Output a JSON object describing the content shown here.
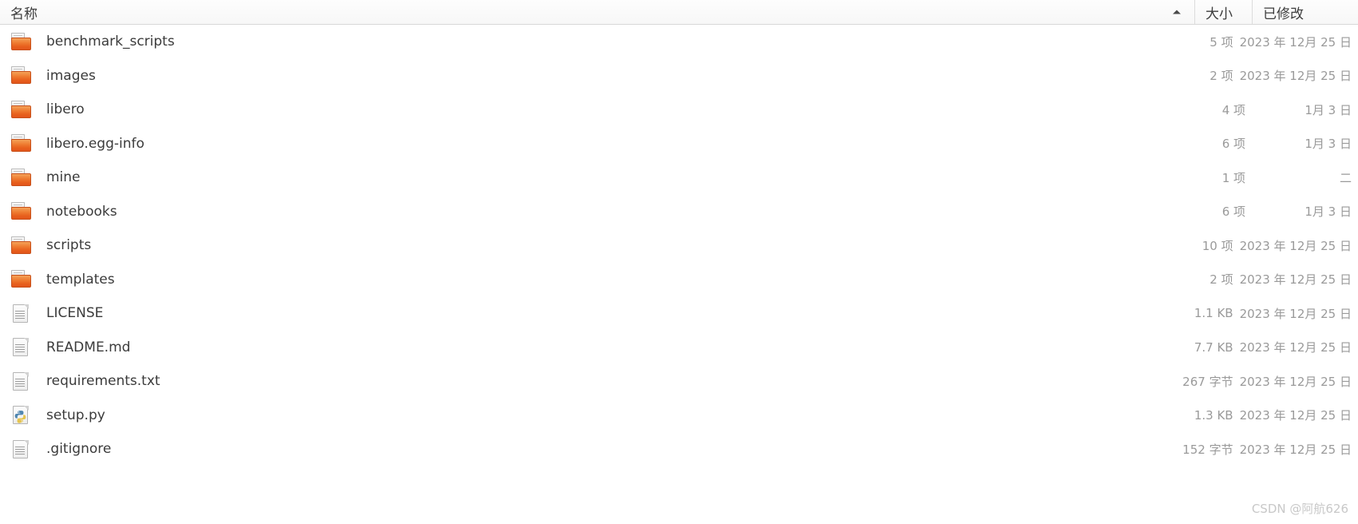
{
  "window": {
    "app": "file-manager-list-view"
  },
  "header": {
    "name_label": "名称",
    "size_label": "大小",
    "modified_label": "已修改",
    "sort_column": "名称",
    "sort_direction": "ascending"
  },
  "columns": [
    "名称",
    "大小",
    "已修改"
  ],
  "rows": [
    {
      "name": "benchmark_scripts",
      "icon": "folder-icon",
      "size": "5 项",
      "modified": "2023 年 12月 25 日"
    },
    {
      "name": "images",
      "icon": "folder-icon",
      "size": "2 项",
      "modified": "2023 年 12月 25 日"
    },
    {
      "name": "libero",
      "icon": "folder-icon",
      "size": "4 项",
      "modified": "1月 3 日"
    },
    {
      "name": "libero.egg-info",
      "icon": "folder-icon",
      "size": "6 项",
      "modified": "1月 3 日"
    },
    {
      "name": "mine",
      "icon": "folder-icon",
      "size": "1 项",
      "modified": "二"
    },
    {
      "name": "notebooks",
      "icon": "folder-icon",
      "size": "6 项",
      "modified": "1月 3 日"
    },
    {
      "name": "scripts",
      "icon": "folder-icon",
      "size": "10 项",
      "modified": "2023 年 12月 25 日"
    },
    {
      "name": "templates",
      "icon": "folder-icon",
      "size": "2 项",
      "modified": "2023 年 12月 25 日"
    },
    {
      "name": "LICENSE",
      "icon": "document-icon",
      "size": "1.1 KB",
      "modified": "2023 年 12月 25 日"
    },
    {
      "name": "README.md",
      "icon": "document-icon",
      "size": "7.7 KB",
      "modified": "2023 年 12月 25 日"
    },
    {
      "name": "requirements.txt",
      "icon": "document-icon",
      "size": "267 字节",
      "modified": "2023 年 12月 25 日"
    },
    {
      "name": "setup.py",
      "icon": "python-file-icon",
      "size": "1.3 KB",
      "modified": "2023 年 12月 25 日"
    },
    {
      "name": ".gitignore",
      "icon": "document-icon",
      "size": "152 字节",
      "modified": "2023 年 12月 25 日"
    }
  ],
  "watermark": {
    "text": "CSDN @阿航626"
  },
  "colors": {
    "folder_accent": "#e8601d",
    "text_primary": "#3b3b3b",
    "text_secondary": "#9a9a9a",
    "header_border": "#d8d8d8",
    "watermark": "#c8c8c8"
  }
}
